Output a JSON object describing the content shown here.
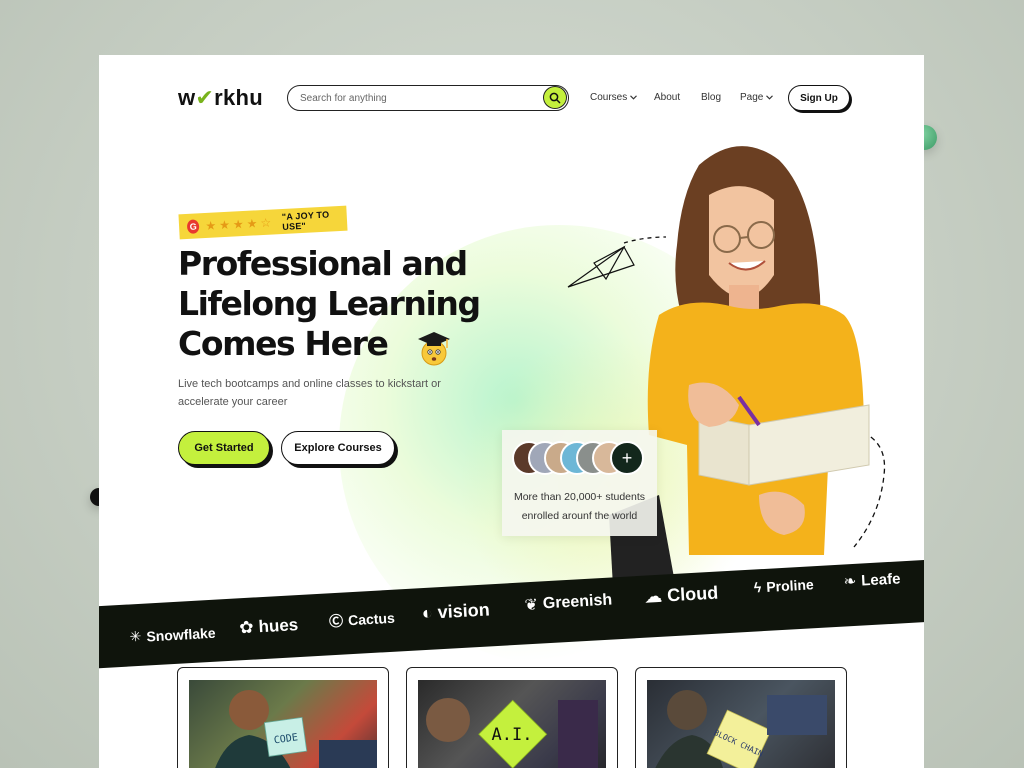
{
  "logo": {
    "prefix": "w",
    "check": "o",
    "suffix": "rkhu"
  },
  "search": {
    "placeholder": "Search for anything",
    "icon": "search-icon"
  },
  "nav": {
    "items": [
      {
        "label": "Courses",
        "dropdown": true
      },
      {
        "label": "About",
        "dropdown": false
      },
      {
        "label": "Blog",
        "dropdown": false
      },
      {
        "label": "Page",
        "dropdown": true
      }
    ],
    "signup_label": "Sign Up"
  },
  "hero": {
    "badge": {
      "rating_stars": 4.5,
      "quote": "\"A JOY TO USE\"",
      "source_icon": "g2-logo-icon"
    },
    "headline_lines": [
      "Professional and",
      "Lifelong Learning",
      "Comes Here"
    ],
    "subtitle": "Live tech bootcamps and online classes to kickstart or accelerate your career",
    "primary_cta": "Get Started",
    "secondary_cta": "Explore Courses"
  },
  "students": {
    "text_line1": "More than 20,000+ students",
    "text_line2": "enrolled arounf the world",
    "plus_icon": "plus-icon"
  },
  "brands": [
    "Snowflake",
    "hues",
    "Cactus",
    "vision",
    "Greenish",
    "Cloud",
    "Proline",
    "Leafe"
  ],
  "courses": [
    {
      "sticky_note": "CODE",
      "note_color": "#c8efe6"
    },
    {
      "sticky_note": "A.I.",
      "note_color": "#c4f03d"
    },
    {
      "sticky_note": "BLOCK CHAIN",
      "note_color": "#f3f09a"
    }
  ],
  "colors": {
    "accent": "#c4f03d",
    "dark": "#0f140c",
    "badge": "#f6d63a",
    "shirt": "#f4b21b"
  }
}
